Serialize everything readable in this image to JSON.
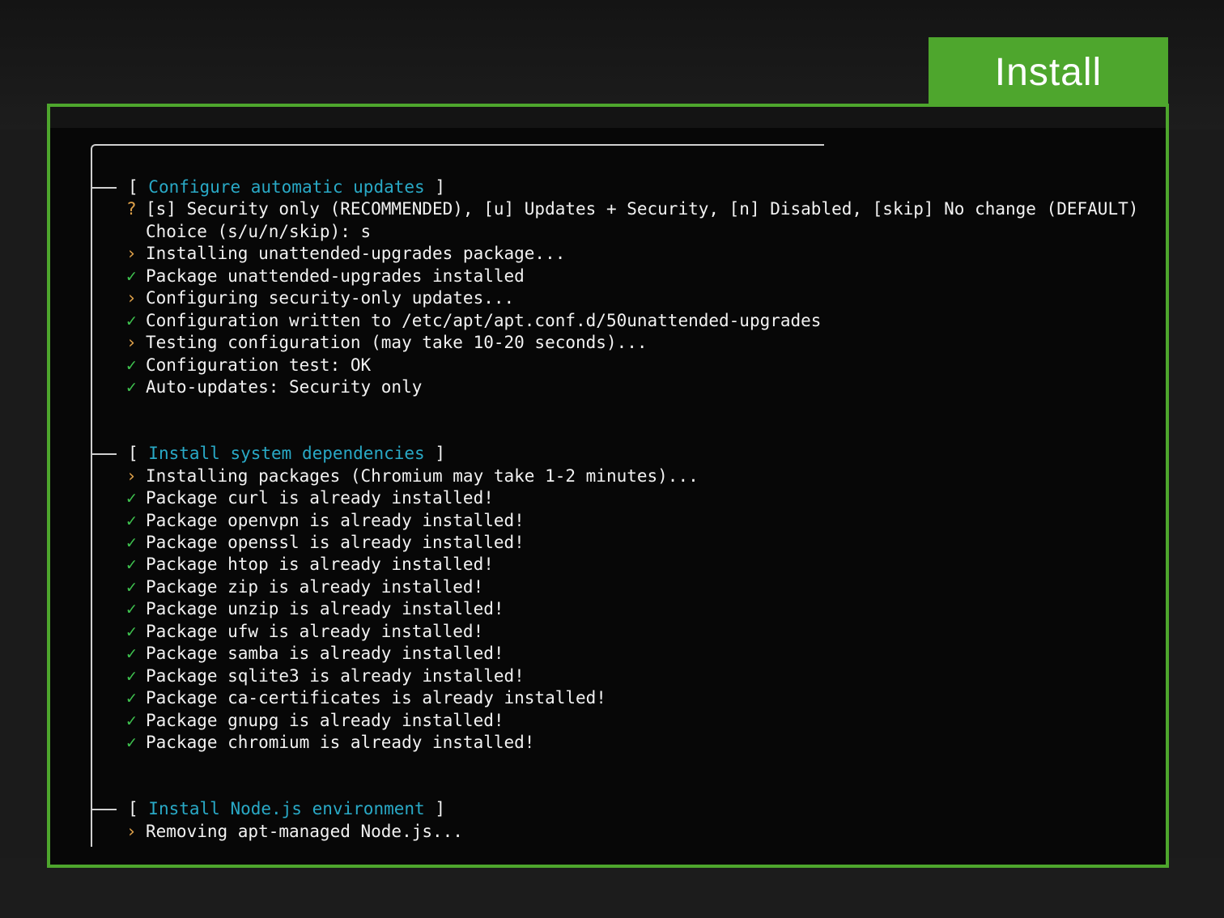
{
  "header": {
    "tab_label": "Install"
  },
  "colors": {
    "accent": "#4ea62d",
    "section_title": "#29a9c6",
    "check": "#3ec24f",
    "arrow": "#e0a24a"
  },
  "terminal": {
    "sections": [
      {
        "title": "Configure automatic updates",
        "lines": [
          {
            "icon": "question-icon",
            "symbol": "?",
            "text": "[s] Security only (RECOMMENDED), [u] Updates + Security, [n] Disabled, [skip] No change (DEFAULT)"
          },
          {
            "icon": "none",
            "symbol": "",
            "text": "Choice (s/u/n/skip): s"
          },
          {
            "icon": "arrow-icon",
            "symbol": "›",
            "text": "Installing unattended-upgrades package..."
          },
          {
            "icon": "check-icon",
            "symbol": "✓",
            "text": "Package unattended-upgrades installed"
          },
          {
            "icon": "arrow-icon",
            "symbol": "›",
            "text": "Configuring security-only updates..."
          },
          {
            "icon": "check-icon",
            "symbol": "✓",
            "text": "Configuration written to /etc/apt/apt.conf.d/50unattended-upgrades"
          },
          {
            "icon": "arrow-icon",
            "symbol": "›",
            "text": "Testing configuration (may take 10-20 seconds)..."
          },
          {
            "icon": "check-icon",
            "symbol": "✓",
            "text": "Configuration test: OK"
          },
          {
            "icon": "check-icon",
            "symbol": "✓",
            "text": "Auto-updates: Security only"
          }
        ]
      },
      {
        "title": "Install system dependencies",
        "lines": [
          {
            "icon": "arrow-icon",
            "symbol": "›",
            "text": "Installing packages (Chromium may take 1-2 minutes)..."
          },
          {
            "icon": "check-icon",
            "symbol": "✓",
            "text": "Package curl is already installed!"
          },
          {
            "icon": "check-icon",
            "symbol": "✓",
            "text": "Package openvpn is already installed!"
          },
          {
            "icon": "check-icon",
            "symbol": "✓",
            "text": "Package openssl is already installed!"
          },
          {
            "icon": "check-icon",
            "symbol": "✓",
            "text": "Package htop is already installed!"
          },
          {
            "icon": "check-icon",
            "symbol": "✓",
            "text": "Package zip is already installed!"
          },
          {
            "icon": "check-icon",
            "symbol": "✓",
            "text": "Package unzip is already installed!"
          },
          {
            "icon": "check-icon",
            "symbol": "✓",
            "text": "Package ufw is already installed!"
          },
          {
            "icon": "check-icon",
            "symbol": "✓",
            "text": "Package samba is already installed!"
          },
          {
            "icon": "check-icon",
            "symbol": "✓",
            "text": "Package sqlite3 is already installed!"
          },
          {
            "icon": "check-icon",
            "symbol": "✓",
            "text": "Package ca-certificates is already installed!"
          },
          {
            "icon": "check-icon",
            "symbol": "✓",
            "text": "Package gnupg is already installed!"
          },
          {
            "icon": "check-icon",
            "symbol": "✓",
            "text": "Package chromium is already installed!"
          }
        ]
      },
      {
        "title": "Install Node.js environment",
        "lines": [
          {
            "icon": "arrow-icon",
            "symbol": "›",
            "text": "Removing apt-managed Node.js..."
          }
        ]
      }
    ]
  }
}
